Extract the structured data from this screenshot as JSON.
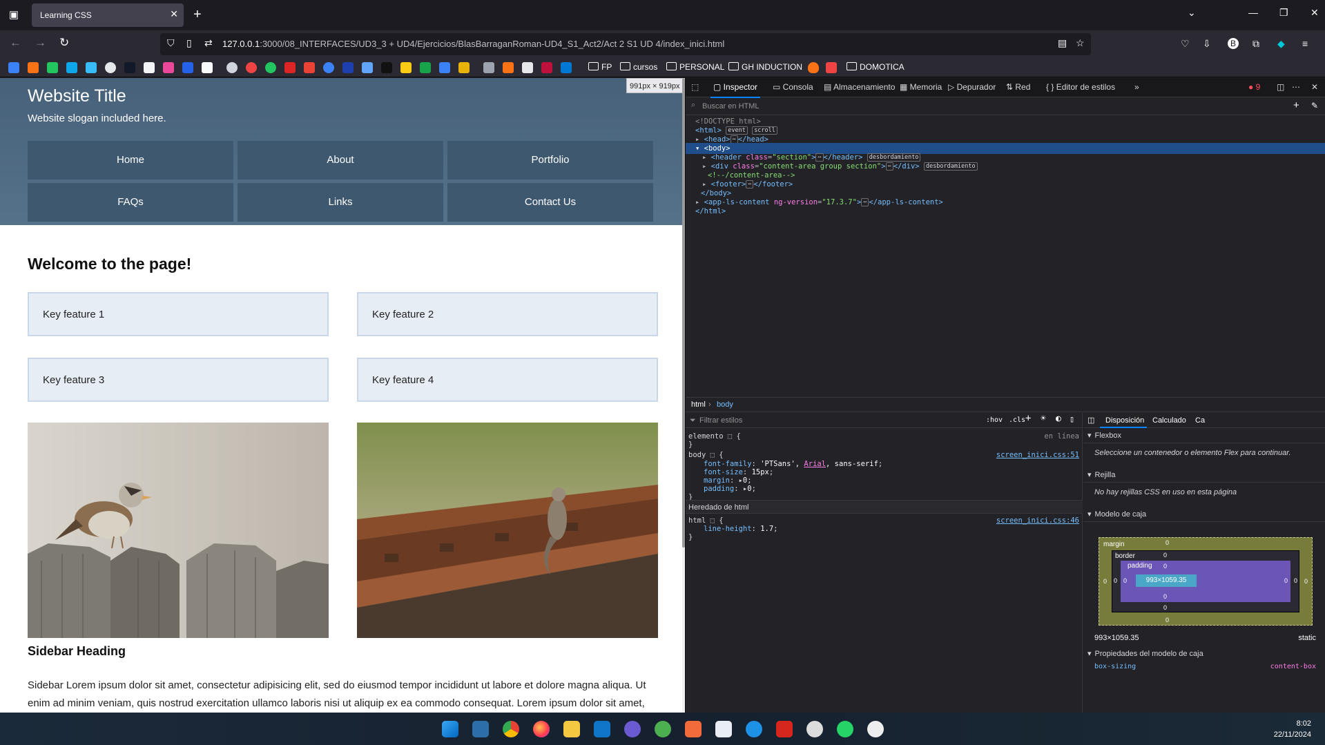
{
  "browser": {
    "tab_title": "Learning CSS",
    "url_host": "127.0.0.1",
    "url_rest": ":3000/08_INTERFACES/UD3_3 + UD4/Ejercicios/BlasBarraganRoman-UD4_S1_Act2/Act 2 S1 UD 4/index_inici.html",
    "bookmarks": [
      "FP",
      "cursos",
      "PERSONAL",
      "GH INDUCTION",
      "DOMOTICA"
    ]
  },
  "page": {
    "site_title": "Website Title",
    "slogan": "Website slogan included here.",
    "nav": [
      "Home",
      "About",
      "Portfolio",
      "FAQs",
      "Links",
      "Contact Us"
    ],
    "welcome": "Welcome to the page!",
    "features": [
      "Key feature 1",
      "Key feature 2",
      "Key feature 3",
      "Key feature 4"
    ],
    "sidebar_heading": "Sidebar Heading",
    "sidebar_text": "Sidebar Lorem ipsum dolor sit amet, consectetur adipisicing elit, sed do eiusmod tempor incididunt ut labore et dolore magna aliqua. Ut enim ad minim veniam, quis nostrud exercitation ullamco laboris nisi ut aliquip ex ea commodo consequat. Lorem ipsum dolor sit amet,"
  },
  "viewport_badge": "991px × 919px",
  "devtools": {
    "tabs": [
      "Inspector",
      "Consola",
      "Almacenamiento",
      "Memoria",
      "Depurador",
      "Red",
      "Editor de estilos"
    ],
    "error_count": "9",
    "search_placeholder": "Buscar en HTML",
    "breadcrumb": [
      "html",
      "body"
    ],
    "filter_placeholder": "Filtrar estilos",
    "hov": ":hov",
    "cls": ".cls",
    "element_rule": "elemento",
    "element_src": "en línea",
    "body_src": "screen_inici.css:51",
    "inherited_label": "Heredado de html",
    "html_src": "screen_inici.css:46",
    "layout_tabs": [
      "Disposición",
      "Calculado",
      "Ca"
    ],
    "flexbox_title": "Flexbox",
    "flexbox_text": "Seleccione un contenedor o elemento Flex para continuar.",
    "grid_title": "Rejilla",
    "grid_text": "No hay rejillas CSS en uso en esta página",
    "boxmodel_title": "Modelo de caja",
    "box_margin": "margin",
    "box_border": "border",
    "box_padding": "padding",
    "box_zero": "0",
    "box_size": "993×1059.35",
    "box_static": "static",
    "box_props_title": "Propiedades del modelo de caja",
    "box_sizing_prop": "box-sizing",
    "box_sizing_val": "content-box"
  },
  "taskbar": {
    "time": "8:02",
    "date": "22/11/2024"
  },
  "colors": {
    "header_bg": "#4e6a83",
    "nav_bg": "#3e5870",
    "feature_bg": "#e6edf5",
    "devtools_bg": "#232327",
    "selection": "#204e8a"
  }
}
